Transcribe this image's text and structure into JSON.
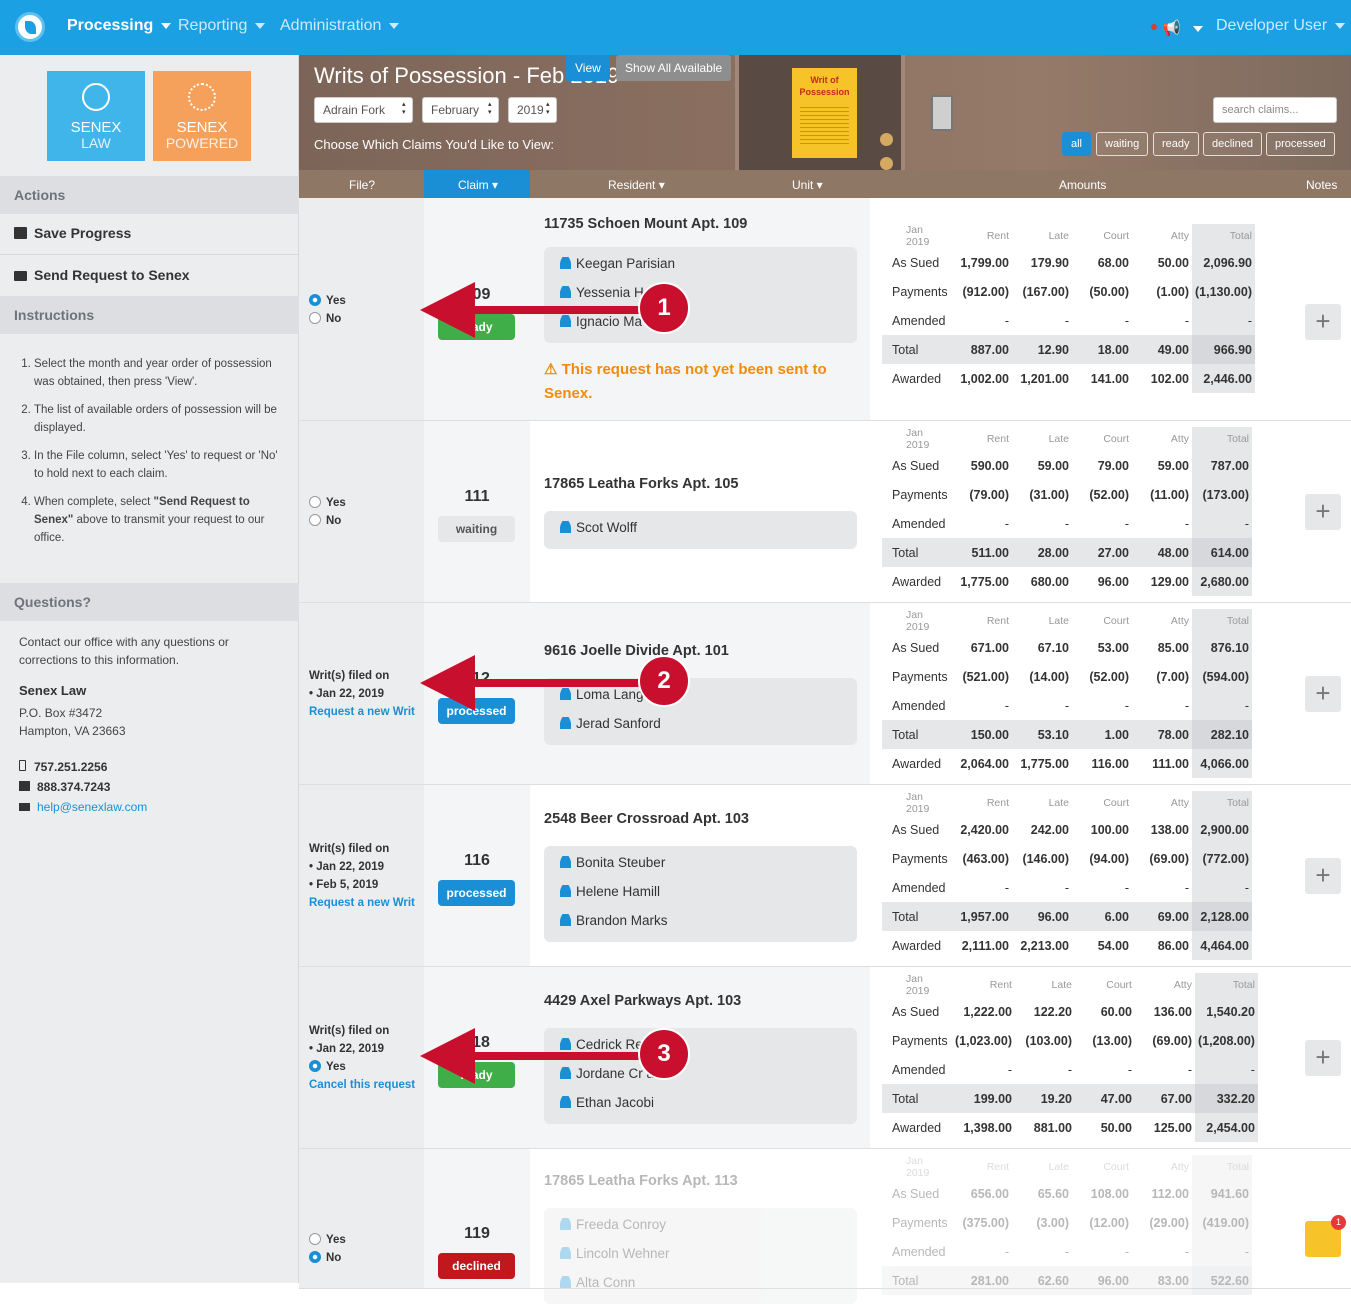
{
  "nav": {
    "processing": "Processing",
    "reporting": "Reporting",
    "administration": "Administration",
    "user": "Developer User"
  },
  "brand": {
    "law_line1": "SENEX",
    "law_line2": "LAW",
    "powered_line1": "SENEX",
    "powered_line2": "POWERED"
  },
  "sidebar": {
    "actions_header": "Actions",
    "save": "Save Progress",
    "send": "Send Request to Senex",
    "instructions_header": "Instructions",
    "steps": [
      "Select the month and year order of possession was obtained, then press 'View'.",
      "The list of available orders of possession will be displayed.",
      "In the File column, select 'Yes' to request or 'No' to hold next to each claim."
    ],
    "step4_a": "When complete, select ",
    "step4_b": "\"Send Request to Senex\"",
    "step4_c": " above to transmit your request to our office.",
    "questions_header": "Questions?",
    "questions_text": "Contact our office with any questions or corrections to this information.",
    "firm": "Senex Law",
    "po": "P.O. Box #3472",
    "city": "Hampton, VA 23663",
    "phone": "757.251.2256",
    "fax": "888.374.7243",
    "email": "help@senexlaw.com"
  },
  "header": {
    "title": "Writs of Possession - Feb 2019",
    "attorney": "Adrain Fork",
    "month": "February",
    "year": "2019",
    "view": "View",
    "show_all": "Show All Available",
    "choose": "Choose Which Claims You'd Like to View:",
    "search_placeholder": "search claims...",
    "notice_title": "Writ of Possession",
    "filters": [
      "all",
      "waiting",
      "ready",
      "declined",
      "processed"
    ]
  },
  "columns": {
    "file": "File?",
    "claim": "Claim ▾",
    "resident": "Resident ▾",
    "unit": "Unit ▾",
    "amounts": "Amounts",
    "notes": "Notes"
  },
  "amount_headers": [
    "Jan 2019",
    "Rent",
    "Late",
    "Court",
    "Atty",
    "Total"
  ],
  "amount_labels": [
    "As Sued",
    "Payments",
    "Amended",
    "Total",
    "Awarded"
  ],
  "yes": "Yes",
  "no": "No",
  "rows": [
    {
      "claim": "109",
      "status": "ready",
      "address": "11735 Schoen Mount Apt. 109",
      "residents": [
        "Keegan Parisian",
        "Yessenia H",
        "Ignacio Ma"
      ],
      "warning": "This request has not yet been sent to Senex.",
      "as_sued": [
        "1,799.00",
        "179.90",
        "68.00",
        "50.00",
        "2,096.90"
      ],
      "payments": [
        "(912.00)",
        "(167.00)",
        "(50.00)",
        "(1.00)",
        "(1,130.00)"
      ],
      "amended": [
        "-",
        "-",
        "-",
        "-",
        "-"
      ],
      "total": [
        "887.00",
        "12.90",
        "18.00",
        "49.00",
        "966.90"
      ],
      "awarded": [
        "1,002.00",
        "1,201.00",
        "141.00",
        "102.00",
        "2,446.00"
      ]
    },
    {
      "claim": "111",
      "status": "waiting",
      "address": "17865 Leatha Forks Apt. 105",
      "residents": [
        "Scot Wolff"
      ],
      "as_sued": [
        "590.00",
        "59.00",
        "79.00",
        "59.00",
        "787.00"
      ],
      "payments": [
        "(79.00)",
        "(31.00)",
        "(52.00)",
        "(11.00)",
        "(173.00)"
      ],
      "amended": [
        "-",
        "-",
        "-",
        "-",
        "-"
      ],
      "total": [
        "511.00",
        "28.00",
        "27.00",
        "48.00",
        "614.00"
      ],
      "awarded": [
        "1,775.00",
        "680.00",
        "96.00",
        "129.00",
        "2,680.00"
      ]
    },
    {
      "claim": "112",
      "status": "processed",
      "address": "9616 Joelle Divide Apt. 101",
      "residents": [
        "Loma Lang",
        "Jerad Sanford"
      ],
      "filed_label": "Writ(s) filed on",
      "filed_dates": [
        "• Jan 22, 2019"
      ],
      "link": "Request a new Writ",
      "as_sued": [
        "671.00",
        "67.10",
        "53.00",
        "85.00",
        "876.10"
      ],
      "payments": [
        "(521.00)",
        "(14.00)",
        "(52.00)",
        "(7.00)",
        "(594.00)"
      ],
      "amended": [
        "-",
        "-",
        "-",
        "-",
        "-"
      ],
      "total": [
        "150.00",
        "53.10",
        "1.00",
        "78.00",
        "282.10"
      ],
      "awarded": [
        "2,064.00",
        "1,775.00",
        "116.00",
        "111.00",
        "4,066.00"
      ]
    },
    {
      "claim": "116",
      "status": "processed",
      "address": "2548 Beer Crossroad Apt. 103",
      "residents": [
        "Bonita Steuber",
        "Helene Hamill",
        "Brandon Marks"
      ],
      "filed_label": "Writ(s) filed on",
      "filed_dates": [
        "• Jan 22, 2019",
        "• Feb 5, 2019"
      ],
      "link": "Request a new Writ",
      "as_sued": [
        "2,420.00",
        "242.00",
        "100.00",
        "138.00",
        "2,900.00"
      ],
      "payments": [
        "(463.00)",
        "(146.00)",
        "(94.00)",
        "(69.00)",
        "(772.00)"
      ],
      "amended": [
        "-",
        "-",
        "-",
        "-",
        "-"
      ],
      "total": [
        "1,957.00",
        "96.00",
        "6.00",
        "69.00",
        "2,128.00"
      ],
      "awarded": [
        "2,111.00",
        "2,213.00",
        "54.00",
        "86.00",
        "4,464.00"
      ]
    },
    {
      "claim": "118",
      "status": "ready",
      "address": "4429 Axel Parkways Apt. 103",
      "residents": [
        "Cedrick Re",
        "Jordane Cr ank",
        "Ethan Jacobi"
      ],
      "filed_label": "Writ(s) filed on",
      "filed_dates": [
        "• Jan 22, 2019"
      ],
      "link": "Cancel this request",
      "as_sued": [
        "1,222.00",
        "122.20",
        "60.00",
        "136.00",
        "1,540.20"
      ],
      "payments": [
        "(1,023.00)",
        "(103.00)",
        "(13.00)",
        "(69.00)",
        "(1,208.00)"
      ],
      "amended": [
        "-",
        "-",
        "-",
        "-",
        "-"
      ],
      "total": [
        "199.00",
        "19.20",
        "47.00",
        "67.00",
        "332.20"
      ],
      "awarded": [
        "1,398.00",
        "881.00",
        "50.00",
        "125.00",
        "2,454.00"
      ]
    },
    {
      "claim": "119",
      "status": "declined",
      "address": "17865 Leatha Forks Apt. 113",
      "residents": [
        "Freeda Conroy",
        "Lincoln Wehner",
        "Alta Conn"
      ],
      "as_sued": [
        "656.00",
        "65.60",
        "108.00",
        "112.00",
        "941.60"
      ],
      "payments": [
        "(375.00)",
        "(3.00)",
        "(12.00)",
        "(29.00)",
        "(419.00)"
      ],
      "amended": [
        "-",
        "-",
        "-",
        "-",
        "-"
      ],
      "total": [
        "281.00",
        "62.60",
        "96.00",
        "83.00",
        "522.60"
      ]
    }
  ],
  "note_count": "1",
  "callouts": [
    "1",
    "2",
    "3"
  ],
  "colors": {
    "blue": "#1a8fd6",
    "ready": "#3fae49",
    "waiting": "#e6e7e9",
    "processed": "#1a8fd6",
    "declined": "#c0181c",
    "arrow": "#c8102e"
  }
}
